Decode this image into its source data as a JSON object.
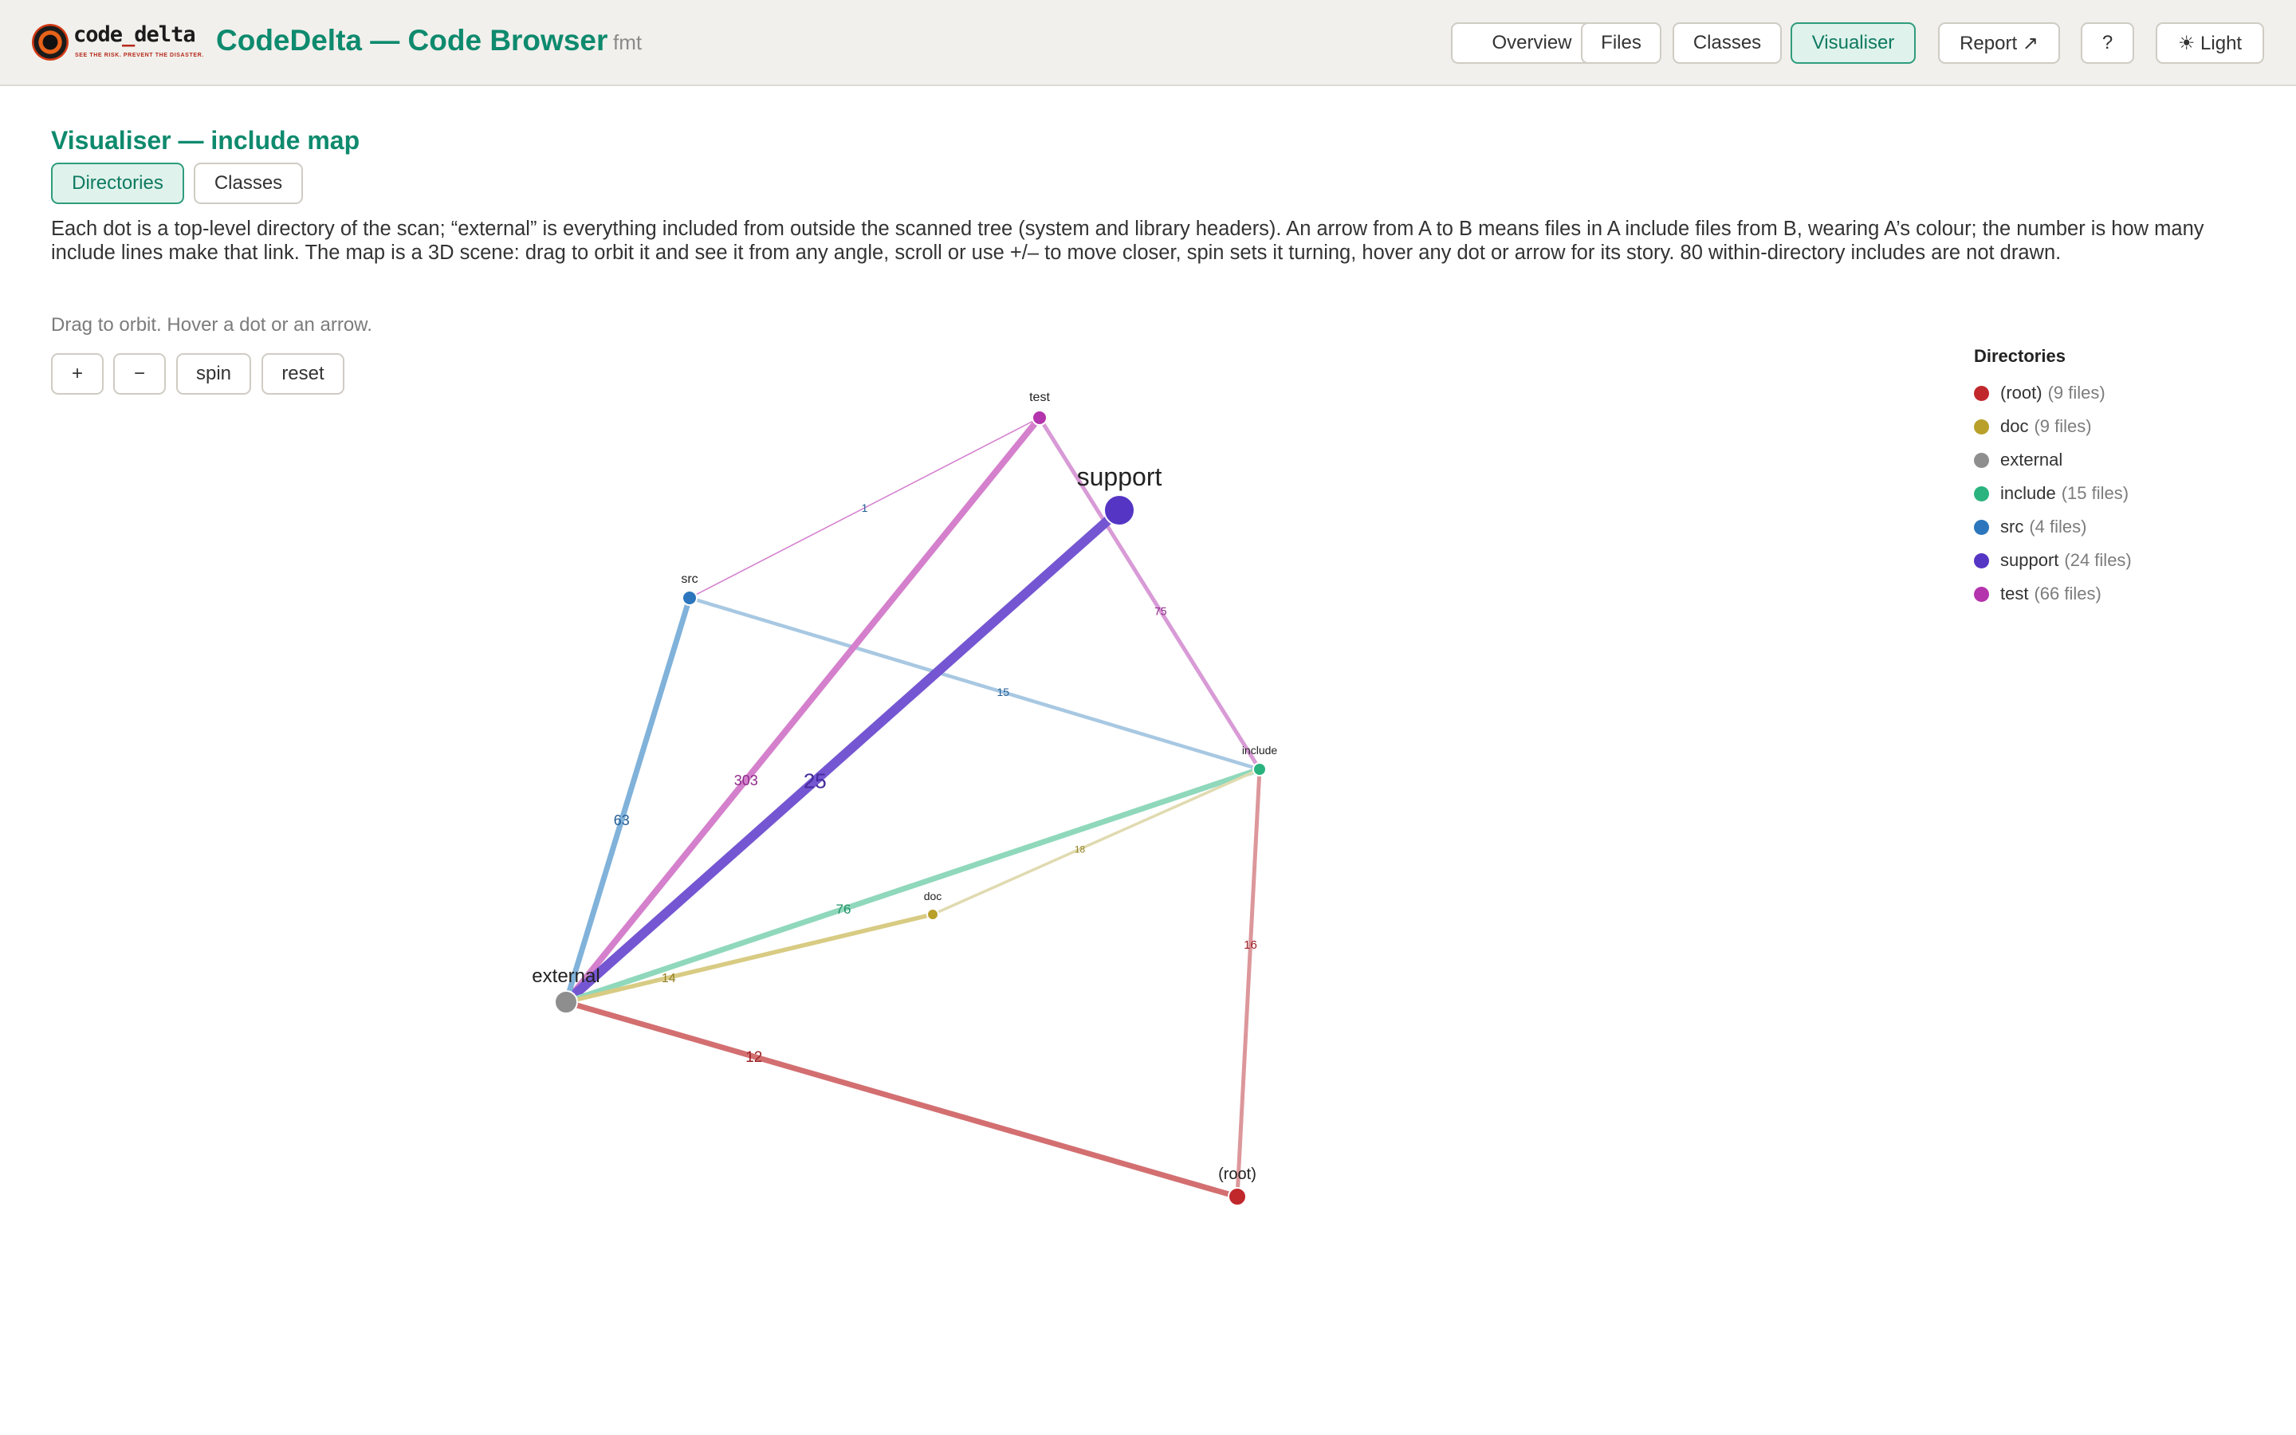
{
  "app": {
    "logo_text_a": "code",
    "logo_text_b": "_",
    "logo_text_c": "delta",
    "logo_tagline": "SEE THE RISK. PREVENT THE DISASTER.",
    "title": "CodeDelta — Code Browser",
    "project": "fmt"
  },
  "nav": {
    "overview": "Overview",
    "files": "Files",
    "classes": "Classes",
    "visualiser": "Visualiser",
    "report": "Report ↗",
    "help": "?",
    "theme": "☀ Light",
    "active": "visualiser"
  },
  "page": {
    "heading": "Visualiser — include map",
    "toggle_directories": "Directories",
    "toggle_classes": "Classes",
    "description": "Each dot is a top-level directory of the scan; “external” is everything included from outside the scanned tree (system and library headers). An arrow from A to B means files in A include files from B, wearing A’s colour; the number is how many include lines make that link. The map is a 3D scene: drag to orbit it and see it from any angle, scroll or use +/– to move closer, spin sets it turning, hover any dot or arrow for its story. 80 within-directory includes are not drawn.",
    "hint": "Drag to orbit. Hover a dot or an arrow.",
    "controls": {
      "zoom_in": "+",
      "zoom_out": "−",
      "spin": "spin",
      "reset": "reset"
    }
  },
  "legend": {
    "title": "Directories",
    "items": [
      {
        "name": "(root)",
        "files": "(9 files)",
        "color": "#c0282c"
      },
      {
        "name": "doc",
        "files": "(9 files)",
        "color": "#b8a02a"
      },
      {
        "name": "external",
        "files": "",
        "color": "#8e8e8e"
      },
      {
        "name": "include",
        "files": "(15 files)",
        "color": "#2ab37e"
      },
      {
        "name": "src",
        "files": "(4 files)",
        "color": "#2c76bd"
      },
      {
        "name": "support",
        "files": "(24 files)",
        "color": "#5535c4"
      },
      {
        "name": "test",
        "files": "(66 files)",
        "color": "#b334ac"
      }
    ]
  },
  "graph": {
    "nodes": [
      {
        "id": "test",
        "label": "test",
        "color": "#b334ac"
      },
      {
        "id": "support",
        "label": "support",
        "color": "#5535c4"
      },
      {
        "id": "src",
        "label": "src",
        "color": "#2c76bd"
      },
      {
        "id": "include",
        "label": "include",
        "color": "#2ab37e"
      },
      {
        "id": "doc",
        "label": "doc",
        "color": "#b8a02a"
      },
      {
        "id": "external",
        "label": "external",
        "color": "#8e8e8e"
      },
      {
        "id": "root",
        "label": "(root)",
        "color": "#c0282c"
      }
    ],
    "edges": [
      {
        "from": "src",
        "to": "test",
        "count": "1",
        "color": "#d47fcf"
      },
      {
        "from": "test",
        "to": "include",
        "count": "75",
        "color": "#d89bd6"
      },
      {
        "from": "src",
        "to": "include",
        "count": "15",
        "color": "#a8c8e2"
      },
      {
        "from": "test",
        "to": "external",
        "count": "303",
        "color": "#d480cc"
      },
      {
        "from": "support",
        "to": "external",
        "count": "25",
        "color": "#7556d2"
      },
      {
        "from": "src",
        "to": "external",
        "count": "63",
        "color": "#80b2da"
      },
      {
        "from": "include",
        "to": "external",
        "count": "76",
        "color": "#8fd8bb"
      },
      {
        "from": "doc",
        "to": "include",
        "count": "18",
        "color": "#e0dab0"
      },
      {
        "from": "doc",
        "to": "external",
        "count": "14",
        "color": "#d8cb83"
      },
      {
        "from": "root",
        "to": "include",
        "count": "16",
        "color": "#dc979b"
      },
      {
        "from": "root",
        "to": "external",
        "count": "12",
        "color": "#d36f71"
      }
    ]
  }
}
